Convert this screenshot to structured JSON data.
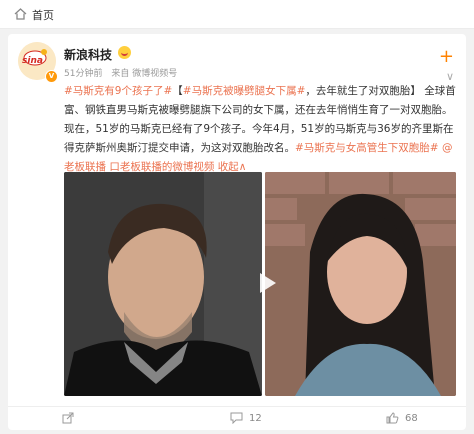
{
  "topbar": {
    "home_label": "首页"
  },
  "post": {
    "author": "新浪科技",
    "avatar_logo": "sina",
    "avatar_subtext": "新浪科技",
    "verified": "V",
    "time": "51分钟前",
    "source": "来自 微博视频号",
    "follow": "+",
    "more": "∨",
    "text": {
      "tag1": "#马斯克有9个孩子了#",
      "t2": "【",
      "tag2": "#马斯克被曝劈腿女下属#",
      "t3": "，去年就生了对双胞胎】 全球首富、钢铁直男马斯克被曝劈腿旗下公司的女下属，还在去年悄悄生育了一对双胞胎。现在，51岁的马斯克已经有了9个孩子。今年4月，51岁的马斯克与36岁的齐里斯在得克萨斯州奥斯汀提交申请，为这对双胞胎改名。",
      "tag3": "#马斯克与女高管生下双胞胎#",
      "t4": " ",
      "link1": "@老板联播",
      "t5": " ",
      "link2": "口老板联播的微博视频",
      "t6": " ",
      "link3": "收起",
      "link3_arrow": "∧"
    }
  },
  "actions": {
    "share": "",
    "comments": "12",
    "likes": "68"
  },
  "colors": {
    "accent": "#eb7350",
    "brand": "#ff8200"
  },
  "icons": [
    "home-icon",
    "avatar",
    "emoji-icon",
    "verified-badge",
    "play-icon",
    "share-icon",
    "comment-icon",
    "like-icon"
  ]
}
